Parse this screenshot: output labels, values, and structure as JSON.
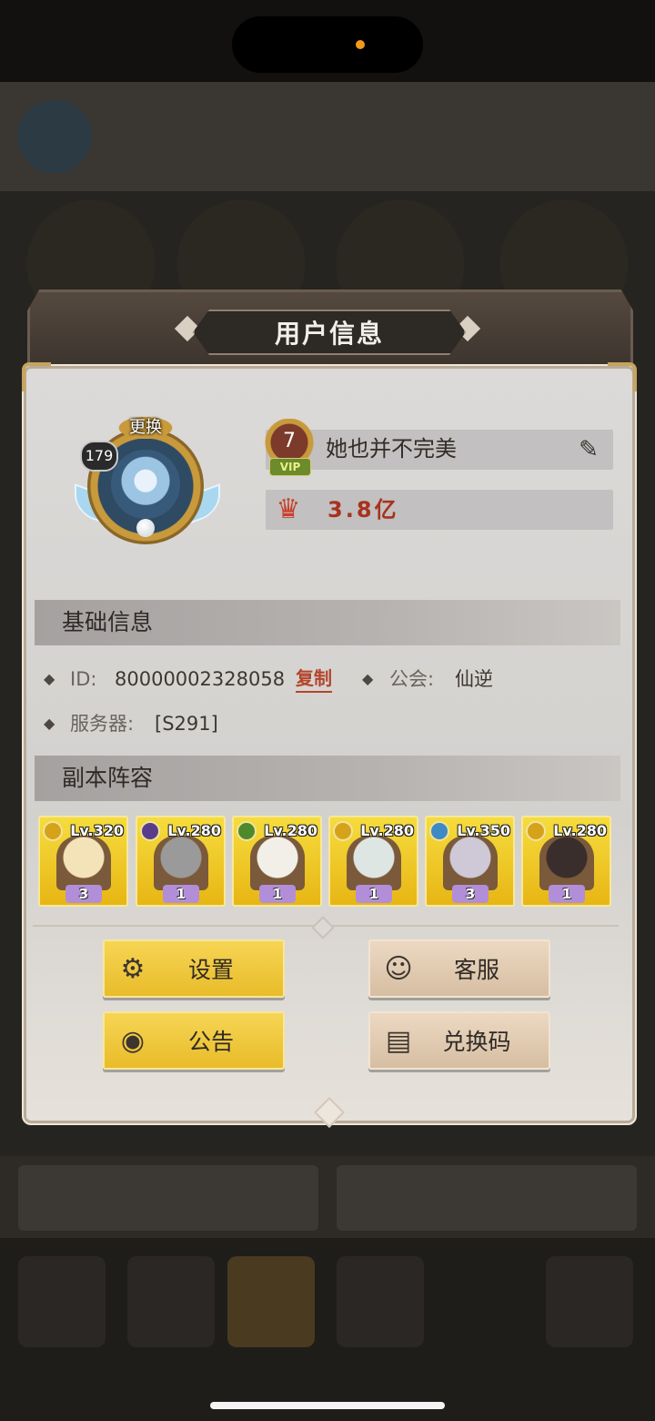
{
  "dialog": {
    "title": "用户信息"
  },
  "profile": {
    "avatar_change_label": "更换",
    "player_level": "179",
    "vip_level": "7",
    "vip_tag": "VIP",
    "nickname": "她也并不完美",
    "power": "3.8亿"
  },
  "basic_info": {
    "section_title": "基础信息",
    "id_label": "ID:",
    "id_value": "80000002328058",
    "copy_label": "复制",
    "guild_label": "公会:",
    "guild_value": "仙逆",
    "server_label": "服务器:",
    "server_value": "[S291]"
  },
  "lineup": {
    "section_title": "副本阵容",
    "heroes": [
      {
        "level": "Lv.320",
        "stars": "3",
        "element_color": "#d6a21a",
        "face_color": "#f4e2b8"
      },
      {
        "level": "Lv.280",
        "stars": "1",
        "element_color": "#5a3d8a",
        "face_color": "#9a9a9a"
      },
      {
        "level": "Lv.280",
        "stars": "1",
        "element_color": "#4e8a2c",
        "face_color": "#f1efe8"
      },
      {
        "level": "Lv.280",
        "stars": "1",
        "element_color": "#d6a21a",
        "face_color": "#dde6e2"
      },
      {
        "level": "Lv.350",
        "stars": "3",
        "element_color": "#3e8ac4",
        "face_color": "#cfc8d6"
      },
      {
        "level": "Lv.280",
        "stars": "1",
        "element_color": "#d6a21a",
        "face_color": "#3a2e2c"
      }
    ]
  },
  "buttons": {
    "settings": "设置",
    "support": "客服",
    "notice": "公告",
    "redeem": "兑换码"
  },
  "icons": {
    "edit": "✎",
    "power": "♛",
    "settings": "⚙",
    "support": "☺",
    "notice": "◉",
    "redeem": "▤",
    "diamond": "◆"
  }
}
